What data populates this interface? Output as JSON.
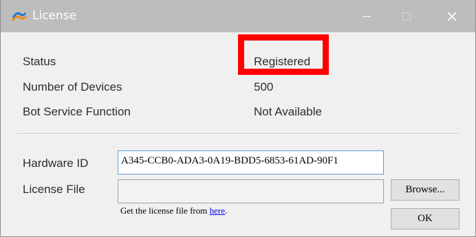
{
  "window": {
    "title": "License",
    "controls": {
      "minimize": "—",
      "maximize": "□",
      "close": "✕"
    }
  },
  "info": [
    {
      "label": "Status",
      "value": "Registered"
    },
    {
      "label": "Number of Devices",
      "value": "500"
    },
    {
      "label": "Bot Service Function",
      "value": "Not Available"
    }
  ],
  "form": {
    "hardware_id_label": "Hardware ID",
    "hardware_id_value": "A345-CCB0-ADA3-0A19-BDD5-6853-61AD-90F1",
    "license_file_label": "License File",
    "license_file_value": "",
    "browse_label": "Browse...",
    "hint_prefix": "Get the license file from ",
    "hint_link": "here",
    "hint_suffix": ".",
    "ok_label": "OK"
  },
  "colors": {
    "titlebar": "#bdbdbd",
    "highlight": "#ff0000",
    "link": "#0000ee"
  }
}
